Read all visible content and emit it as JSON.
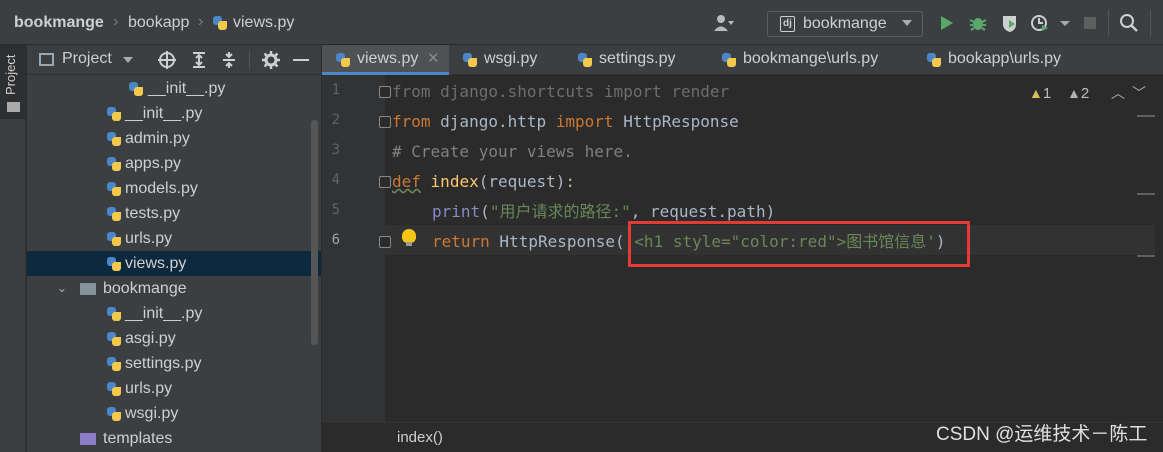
{
  "breadcrumb": {
    "project": "bookmange",
    "folder": "bookapp",
    "file": "views.py"
  },
  "run_config": {
    "label": "bookmange",
    "icon": "django-icon"
  },
  "sidebar": {
    "label": "Project"
  },
  "project_panel": {
    "title": "Project",
    "tree": [
      {
        "name": "__init__.py",
        "type": "py",
        "indent": 0
      },
      {
        "name": "__init__.py",
        "type": "py"
      },
      {
        "name": "admin.py",
        "type": "py"
      },
      {
        "name": "apps.py",
        "type": "py"
      },
      {
        "name": "models.py",
        "type": "py"
      },
      {
        "name": "tests.py",
        "type": "py"
      },
      {
        "name": "urls.py",
        "type": "py"
      },
      {
        "name": "views.py",
        "type": "py",
        "selected": true
      },
      {
        "name": "bookmange",
        "type": "folder",
        "expanded": true
      },
      {
        "name": "__init__.py",
        "type": "py"
      },
      {
        "name": "asgi.py",
        "type": "py"
      },
      {
        "name": "settings.py",
        "type": "py"
      },
      {
        "name": "urls.py",
        "type": "py"
      },
      {
        "name": "wsgi.py",
        "type": "py"
      },
      {
        "name": "templates",
        "type": "folder"
      }
    ]
  },
  "tabs": [
    {
      "label": "views.py",
      "active": true
    },
    {
      "label": "wsgi.py"
    },
    {
      "label": "settings.py"
    },
    {
      "label": "bookmange\\urls.py"
    },
    {
      "label": "bookapp\\urls.py"
    }
  ],
  "inspections": {
    "warnings": "1",
    "weak_warnings": "2"
  },
  "code": {
    "line_numbers": [
      "1",
      "2",
      "3",
      "4",
      "5",
      "6"
    ],
    "l1": "from django.shortcuts import render",
    "l2_kw1": "from",
    "l2_mod": " django.http ",
    "l2_kw2": "import",
    "l2_name": " HttpResponse",
    "l3": "# Create your views here.",
    "l4_kw": "def",
    "l4_fn": "index",
    "l4_rest": "(request):",
    "l5_fn": "print",
    "l5_open": "(",
    "l5_str": "\"用户请求的路径:\"",
    "l5_rest": ", request.path)",
    "l6_kw": "return",
    "l6_call": " HttpResponse(",
    "l6_str": "'<h1 style=\"color:red\">图书馆信息'",
    "l6_close": ")"
  },
  "status": {
    "breadcrumb": "index()"
  },
  "watermark": "CSDN @运维技术－陈工"
}
